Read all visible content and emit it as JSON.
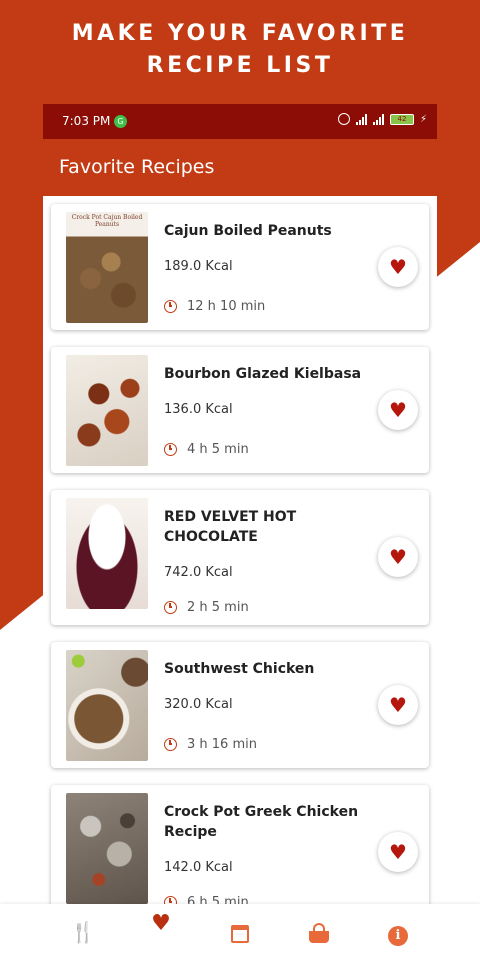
{
  "promo": {
    "headline_line1": "MAKE YOUR FAVORITE",
    "headline_line2": "RECIPE LIST"
  },
  "status_bar": {
    "time": "7:03 PM",
    "notification_badge": "G",
    "battery": "42"
  },
  "app_bar": {
    "title": "Favorite Recipes"
  },
  "recipes": [
    {
      "name": "Cajun Boiled Peanuts",
      "kcal": "189.0 Kcal",
      "time": "12 h 10 min",
      "image_caption": "Crock Pot Cajun Boiled Peanuts",
      "favorite_icon": "heart-icon"
    },
    {
      "name": "Bourbon Glazed Kielbasa",
      "kcal": "136.0 Kcal",
      "time": "4 h 5 min",
      "favorite_icon": "heart-icon"
    },
    {
      "name": "RED VELVET HOT CHOCOLATE",
      "kcal": "742.0 Kcal",
      "time": "2 h 5 min",
      "favorite_icon": "heart-icon"
    },
    {
      "name": "Southwest Chicken",
      "kcal": "320.0 Kcal",
      "time": "3 h 16 min",
      "favorite_icon": "heart-icon"
    },
    {
      "name": "Crock Pot Greek Chicken Recipe",
      "kcal": "142.0 Kcal",
      "time": "6 h 5 min",
      "favorite_icon": "heart-icon"
    }
  ],
  "bottom_nav": {
    "items": [
      {
        "icon": "fork-knife-icon",
        "active": false
      },
      {
        "icon": "heart-icon",
        "active": true
      },
      {
        "icon": "calendar-icon",
        "active": false
      },
      {
        "icon": "basket-icon",
        "active": false
      },
      {
        "icon": "info-icon",
        "active": false
      }
    ]
  },
  "colors": {
    "brand": "#c23b14",
    "status_bar": "#8b0d05",
    "heart": "#b5170d",
    "nav_icon": "#e8693a"
  }
}
